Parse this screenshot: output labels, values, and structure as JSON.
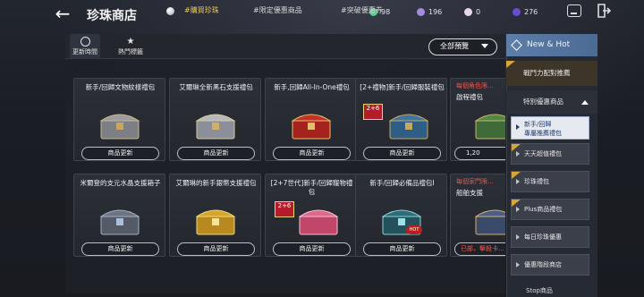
{
  "header": {
    "title": "珍珠商店",
    "back": "←",
    "currencies": [
      {
        "icon": "green-gem-icon",
        "value": "98",
        "color": "#4fd08a"
      },
      {
        "icon": "purple-orb-icon",
        "value": "196",
        "color": "#a58be0"
      },
      {
        "icon": "pearl-icon",
        "value": "0",
        "color": "#e6d6e8"
      },
      {
        "icon": "violet-gem-icon",
        "value": "276",
        "color": "#6a4bd8"
      }
    ]
  },
  "tabs": {
    "latest": "更新時間",
    "popular": "熱門標籤"
  },
  "filters": {
    "pearl": "#購買珍珠",
    "limited": "#限定優惠商品",
    "breakthrough": "#突破優惠券"
  },
  "preview": {
    "label": "全部預覽"
  },
  "items": [
    {
      "name": "新手/回歸文物紋樣禮包",
      "button": "商品更新"
    },
    {
      "name": "艾爾琳全新黑石支援禮包",
      "button": "商品更新"
    },
    {
      "name": "新手,回歸All-In-One禮包",
      "button": "商品更新"
    },
    {
      "name": "[2+禮物]新手/回歸服裝禮包",
      "button": "商品更新"
    },
    {
      "name": "每個角色限...",
      "sub": "啟程禮包",
      "button": "1,20"
    },
    {
      "name": "米爾登的支元水晶支援箱子",
      "button": "商品更新"
    },
    {
      "name": "艾爾琳的新手銀幣支援禮包",
      "button": "商品更新"
    },
    {
      "name": "[2+7世代]新手/回歸寵物禮包",
      "button": "商品更新"
    },
    {
      "name": "新手/回歸必備品禮包I",
      "button": "商品更新"
    },
    {
      "name": "每個家門限...",
      "sub": "船舶支援",
      "button": "已部，擊殺卡..."
    }
  ],
  "badges": {
    "twoplus": "2+6",
    "hot": "HOT"
  },
  "sidebar": {
    "new_hot": "New & Hot",
    "combat": "戰鬥力配對推薦",
    "special": "特別優惠商品",
    "subs": [
      "新手/回歸\n專屬推薦禮包",
      "天天超值禮包",
      "珍珠禮包",
      "Plus商品禮包",
      "每日珍珠優惠",
      "優惠階段商店"
    ],
    "more": "Stop商品"
  }
}
